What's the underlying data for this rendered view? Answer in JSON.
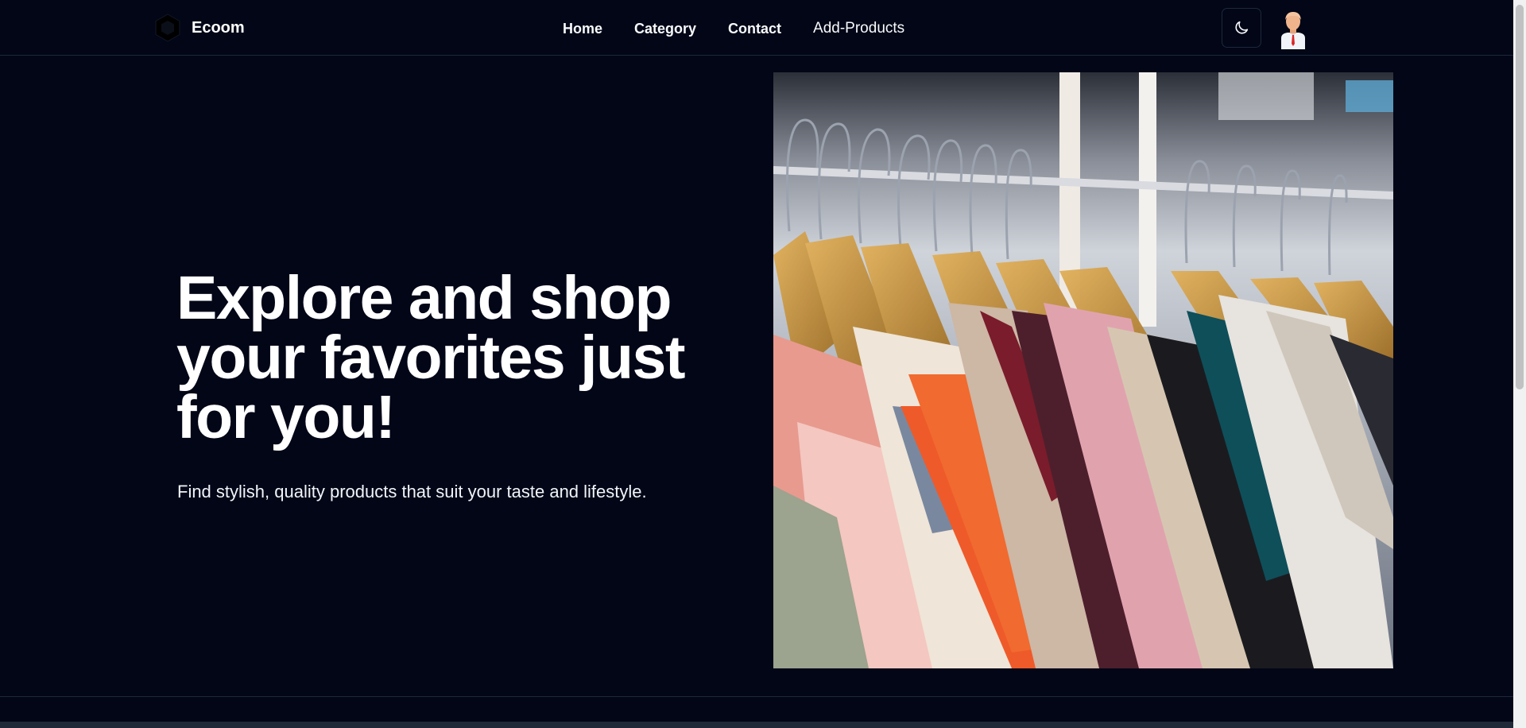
{
  "brand": {
    "name": "Ecoom",
    "logo_icon": "hexagon-logo-icon"
  },
  "nav": {
    "items": [
      {
        "label": "Home"
      },
      {
        "label": "Category"
      },
      {
        "label": "Contact"
      },
      {
        "label": "Add-Products"
      }
    ]
  },
  "header": {
    "theme_toggle_icon": "moon-icon",
    "avatar_icon": "user-avatar-icon"
  },
  "hero": {
    "title": "Explore and shop your favorites just for you!",
    "subtitle": "Find stylish, quality products that suit your taste and lifestyle.",
    "image_alt": "clothes-rack-photo"
  },
  "colors": {
    "background": "#020617",
    "border": "#1e293b",
    "text": "#f8fafc"
  }
}
